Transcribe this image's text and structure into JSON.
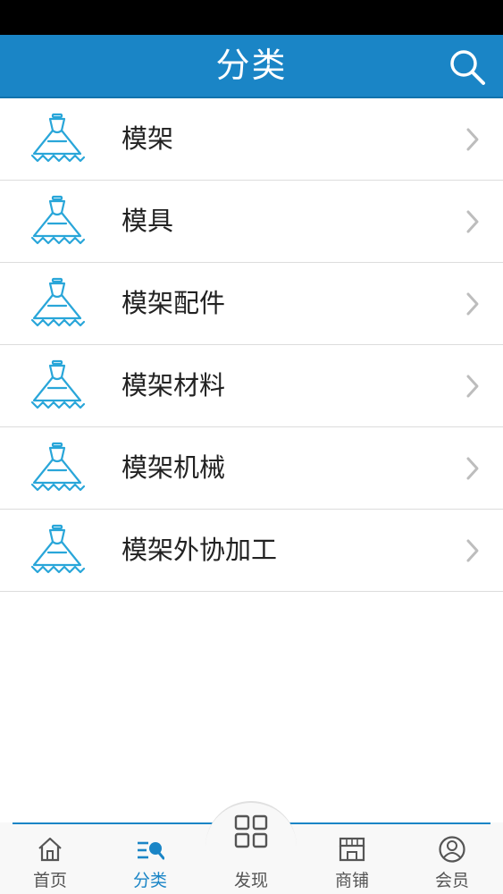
{
  "header": {
    "title": "分类"
  },
  "categories": [
    {
      "label": "模架"
    },
    {
      "label": "模具"
    },
    {
      "label": "模架配件"
    },
    {
      "label": "模架材料"
    },
    {
      "label": "模架机械"
    },
    {
      "label": "模架外协加工"
    }
  ],
  "tabs": [
    {
      "label": "首页",
      "icon": "home-icon"
    },
    {
      "label": "分类",
      "icon": "category-icon",
      "active": true
    },
    {
      "label": "发现",
      "icon": "grid-icon"
    },
    {
      "label": "商铺",
      "icon": "store-icon"
    },
    {
      "label": "会员",
      "icon": "user-icon"
    }
  ],
  "colors": {
    "accent": "#1a85c6",
    "icon": "#29a6d9"
  }
}
